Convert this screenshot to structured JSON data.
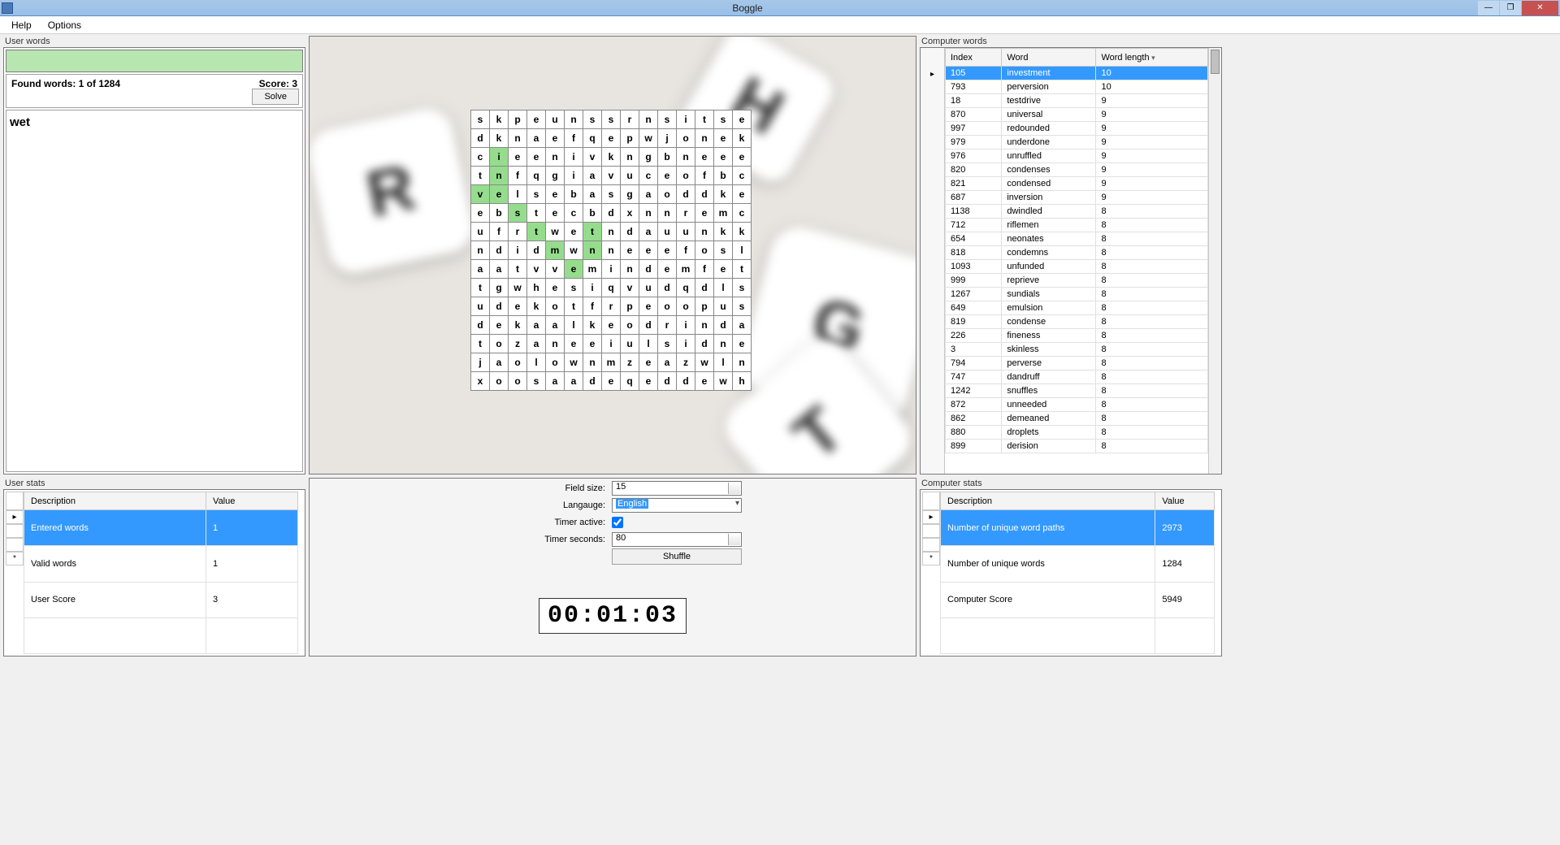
{
  "window": {
    "title": "Boggle"
  },
  "menu": {
    "help": "Help",
    "options": "Options"
  },
  "userWords": {
    "label": "User words",
    "foundText": "Found words: 1 of 1284",
    "scoreText": "Score: 3",
    "solveLabel": "Solve",
    "words": [
      "wet"
    ]
  },
  "board": {
    "rows": [
      [
        "s",
        "k",
        "p",
        "e",
        "u",
        "n",
        "s",
        "s",
        "r",
        "n",
        "s",
        "i",
        "t",
        "s",
        "e"
      ],
      [
        "d",
        "k",
        "n",
        "a",
        "e",
        "f",
        "q",
        "e",
        "p",
        "w",
        "j",
        "o",
        "n",
        "e",
        "k"
      ],
      [
        "c",
        "i",
        "e",
        "e",
        "n",
        "i",
        "v",
        "k",
        "n",
        "g",
        "b",
        "n",
        "e",
        "e",
        "e"
      ],
      [
        "t",
        "n",
        "f",
        "q",
        "g",
        "i",
        "a",
        "v",
        "u",
        "c",
        "e",
        "o",
        "f",
        "b",
        "c"
      ],
      [
        "v",
        "e",
        "l",
        "s",
        "e",
        "b",
        "a",
        "s",
        "g",
        "a",
        "o",
        "d",
        "d",
        "k",
        "e"
      ],
      [
        "e",
        "b",
        "s",
        "t",
        "e",
        "c",
        "b",
        "d",
        "x",
        "n",
        "n",
        "r",
        "e",
        "m",
        "c"
      ],
      [
        "u",
        "f",
        "r",
        "t",
        "w",
        "e",
        "t",
        "n",
        "d",
        "a",
        "u",
        "u",
        "n",
        "k",
        "k"
      ],
      [
        "n",
        "d",
        "i",
        "d",
        "m",
        "w",
        "n",
        "n",
        "e",
        "e",
        "e",
        "f",
        "o",
        "s",
        "l"
      ],
      [
        "a",
        "a",
        "t",
        "v",
        "v",
        "e",
        "m",
        "i",
        "n",
        "d",
        "e",
        "m",
        "f",
        "e",
        "t"
      ],
      [
        "t",
        "g",
        "w",
        "h",
        "e",
        "s",
        "i",
        "q",
        "v",
        "u",
        "d",
        "q",
        "d",
        "l",
        "s"
      ],
      [
        "u",
        "d",
        "e",
        "k",
        "o",
        "t",
        "f",
        "r",
        "p",
        "e",
        "o",
        "o",
        "p",
        "u",
        "s"
      ],
      [
        "d",
        "e",
        "k",
        "a",
        "a",
        "l",
        "k",
        "e",
        "o",
        "d",
        "r",
        "i",
        "n",
        "d",
        "a"
      ],
      [
        "t",
        "o",
        "z",
        "a",
        "n",
        "e",
        "e",
        "i",
        "u",
        "l",
        "s",
        "i",
        "d",
        "n",
        "e"
      ],
      [
        "j",
        "a",
        "o",
        "l",
        "o",
        "w",
        "n",
        "m",
        "z",
        "e",
        "a",
        "z",
        "w",
        "l",
        "n"
      ],
      [
        "x",
        "o",
        "o",
        "s",
        "a",
        "a",
        "d",
        "e",
        "q",
        "e",
        "d",
        "d",
        "e",
        "w",
        "h"
      ]
    ],
    "highlights": [
      [
        2,
        1
      ],
      [
        3,
        1
      ],
      [
        4,
        0
      ],
      [
        4,
        1
      ],
      [
        5,
        2
      ],
      [
        6,
        3
      ],
      [
        6,
        6
      ],
      [
        7,
        4
      ],
      [
        7,
        6
      ],
      [
        8,
        5
      ]
    ]
  },
  "computerWords": {
    "label": "Computer words",
    "headers": {
      "index": "Index",
      "word": "Word",
      "length": "Word length"
    },
    "rows": [
      {
        "i": 105,
        "w": "investment",
        "l": 10,
        "sel": true
      },
      {
        "i": 793,
        "w": "perversion",
        "l": 10
      },
      {
        "i": 18,
        "w": "testdrive",
        "l": 9
      },
      {
        "i": 870,
        "w": "universal",
        "l": 9
      },
      {
        "i": 997,
        "w": "redounded",
        "l": 9
      },
      {
        "i": 979,
        "w": "underdone",
        "l": 9
      },
      {
        "i": 976,
        "w": "unruffled",
        "l": 9
      },
      {
        "i": 820,
        "w": "condenses",
        "l": 9
      },
      {
        "i": 821,
        "w": "condensed",
        "l": 9
      },
      {
        "i": 687,
        "w": "inversion",
        "l": 9
      },
      {
        "i": 1138,
        "w": "dwindled",
        "l": 8
      },
      {
        "i": 712,
        "w": "riflemen",
        "l": 8
      },
      {
        "i": 654,
        "w": "neonates",
        "l": 8
      },
      {
        "i": 818,
        "w": "condemns",
        "l": 8
      },
      {
        "i": 1093,
        "w": "unfunded",
        "l": 8
      },
      {
        "i": 999,
        "w": "reprieve",
        "l": 8
      },
      {
        "i": 1267,
        "w": "sundials",
        "l": 8
      },
      {
        "i": 649,
        "w": "emulsion",
        "l": 8
      },
      {
        "i": 819,
        "w": "condense",
        "l": 8
      },
      {
        "i": 226,
        "w": "fineness",
        "l": 8
      },
      {
        "i": 3,
        "w": "skinless",
        "l": 8
      },
      {
        "i": 794,
        "w": "perverse",
        "l": 8
      },
      {
        "i": 747,
        "w": "dandruff",
        "l": 8
      },
      {
        "i": 1242,
        "w": "snuffles",
        "l": 8
      },
      {
        "i": 872,
        "w": "unneeded",
        "l": 8
      },
      {
        "i": 862,
        "w": "demeaned",
        "l": 8
      },
      {
        "i": 880,
        "w": "droplets",
        "l": 8
      },
      {
        "i": 899,
        "w": "derision",
        "l": 8
      }
    ]
  },
  "controls": {
    "fieldSizeLabel": "Field size:",
    "fieldSizeValue": "15",
    "languageLabel": "Langauge:",
    "languageValue": "English",
    "timerActiveLabel": "Timer active:",
    "timerActive": true,
    "timerSecondsLabel": "Timer seconds:",
    "timerSecondsValue": "80",
    "shuffleLabel": "Shuffle",
    "timer": "00:01:03"
  },
  "userStats": {
    "label": "User stats",
    "headers": {
      "desc": "Description",
      "val": "Value"
    },
    "rows": [
      {
        "d": "Entered words",
        "v": "1",
        "sel": true
      },
      {
        "d": "Valid words",
        "v": "1"
      },
      {
        "d": "User Score",
        "v": "3"
      }
    ]
  },
  "computerStats": {
    "label": "Computer stats",
    "headers": {
      "desc": "Description",
      "val": "Value"
    },
    "rows": [
      {
        "d": "Number of unique word paths",
        "v": "2973",
        "sel": true
      },
      {
        "d": "Number of unique words",
        "v": "1284"
      },
      {
        "d": "Computer Score",
        "v": "5949"
      }
    ]
  }
}
